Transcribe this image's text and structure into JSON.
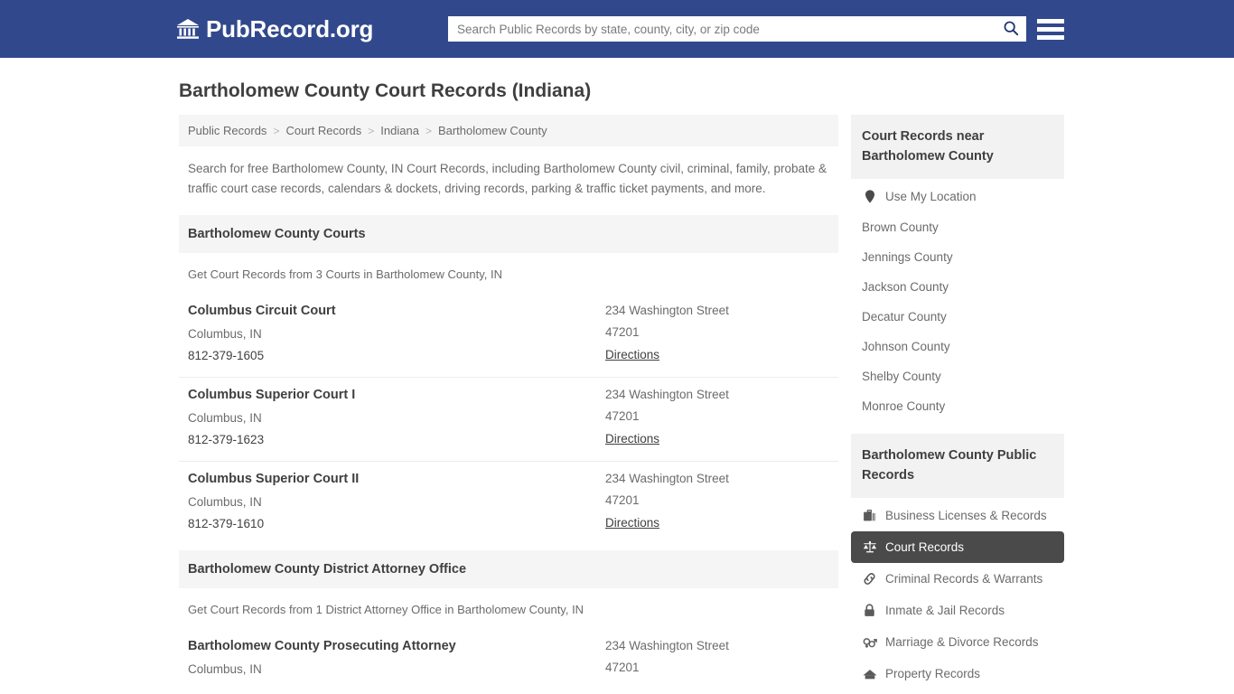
{
  "header": {
    "brand_name": "PubRecord.org",
    "brand_icon": "bank-building-icon",
    "search": {
      "placeholder": "Search Public Records by state, county, city, or zip code",
      "value": "",
      "search_icon": "search-icon"
    },
    "menu_icon": "hamburger-menu-icon",
    "background_color": "#31498c"
  },
  "page": {
    "title": "Bartholomew County Court Records (Indiana)",
    "intro": "Search for free Bartholomew County, IN Court Records, including Bartholomew County civil, criminal, family, probate & traffic court case records, calendars & dockets, driving records, parking & traffic ticket payments, and more."
  },
  "breadcrumb": {
    "separator": ">",
    "items": [
      {
        "label": "Public Records"
      },
      {
        "label": "Court Records"
      },
      {
        "label": "Indiana"
      },
      {
        "label": "Bartholomew County"
      }
    ]
  },
  "sections": [
    {
      "heading": "Bartholomew County Courts",
      "subtitle": "Get Court Records from 3 Courts in Bartholomew County, IN",
      "listings": [
        {
          "name": "Columbus Circuit Court",
          "city_state": "Columbus, IN",
          "phone": "812-379-1605",
          "street": "234 Washington Street",
          "zip": "47201",
          "directions_label": "Directions"
        },
        {
          "name": "Columbus Superior Court I",
          "city_state": "Columbus, IN",
          "phone": "812-379-1623",
          "street": "234 Washington Street",
          "zip": "47201",
          "directions_label": "Directions"
        },
        {
          "name": "Columbus Superior Court II",
          "city_state": "Columbus, IN",
          "phone": "812-379-1610",
          "street": "234 Washington Street",
          "zip": "47201",
          "directions_label": "Directions"
        }
      ]
    },
    {
      "heading": "Bartholomew County District Attorney Office",
      "subtitle": "Get Court Records from 1 District Attorney Office in Bartholomew County, IN",
      "listings": [
        {
          "name": "Bartholomew County Prosecuting Attorney",
          "city_state": "Columbus, IN",
          "phone": "",
          "street": "234 Washington Street",
          "zip": "47201",
          "directions_label": ""
        }
      ]
    }
  ],
  "sidebar": {
    "nearby": {
      "heading": "Court Records near Bartholomew County",
      "use_location": {
        "label": "Use My Location",
        "icon": "map-pin-icon"
      },
      "items": [
        {
          "label": "Brown County"
        },
        {
          "label": "Jennings County"
        },
        {
          "label": "Jackson County"
        },
        {
          "label": "Decatur County"
        },
        {
          "label": "Johnson County"
        },
        {
          "label": "Shelby County"
        },
        {
          "label": "Monroe County"
        }
      ]
    },
    "public_records": {
      "heading": "Bartholomew County Public Records",
      "active_background_color": "#4a4a4a",
      "items": [
        {
          "label": "Business Licenses & Records",
          "icon": "briefcase-icon",
          "active": false
        },
        {
          "label": "Court Records",
          "icon": "scales-of-justice-icon",
          "active": true
        },
        {
          "label": "Criminal Records & Warrants",
          "icon": "chain-link-icon",
          "active": false
        },
        {
          "label": "Inmate & Jail Records",
          "icon": "padlock-icon",
          "active": false
        },
        {
          "label": "Marriage & Divorce Records",
          "icon": "gender-symbols-icon",
          "active": false
        },
        {
          "label": "Property Records",
          "icon": "house-icon",
          "active": false
        }
      ]
    }
  }
}
